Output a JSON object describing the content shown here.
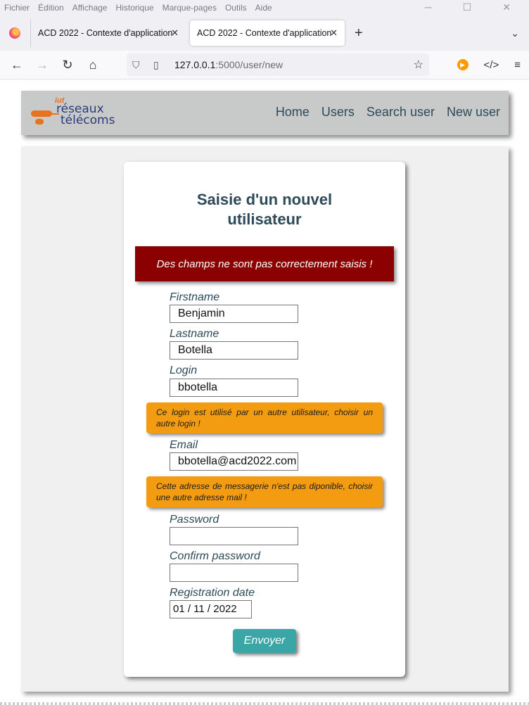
{
  "browser": {
    "menu": [
      "Fichier",
      "Édition",
      "Affichage",
      "Historique",
      "Marque-pages",
      "Outils",
      "Aide"
    ],
    "tabs": [
      {
        "title": "ACD 2022 - Contexte d'application"
      },
      {
        "title": "ACD 2022 - Contexte d'application"
      }
    ],
    "url_host": "127.0.0.1",
    "url_path": ":5000/user/new"
  },
  "site": {
    "logo": {
      "iut": "iut",
      "line1": "réseaux",
      "line2": "télécoms"
    },
    "nav": [
      "Home",
      "Users",
      "Search user",
      "New user"
    ]
  },
  "form": {
    "title": "Saisie d'un nouvel utilisateur",
    "error": "Des champs ne sont pas correctement saisis !",
    "firstname": {
      "label": "Firstname",
      "value": "Benjamin"
    },
    "lastname": {
      "label": "Lastname",
      "value": "Botella"
    },
    "login": {
      "label": "Login",
      "value": "bbotella",
      "warning": "Ce login est utilisé par un autre utilisateur, choisir un autre login !"
    },
    "email": {
      "label": "Email",
      "value": "bbotella@acd2022.com",
      "warning": "Cette adresse de messagerie n'est pas diponible, choisir une autre adresse mail !"
    },
    "password": {
      "label": "Password",
      "value": ""
    },
    "confirm": {
      "label": "Confirm password",
      "value": ""
    },
    "date": {
      "label": "Registration date",
      "value": "01 / 11 / 2022"
    },
    "submit": "Envoyer"
  },
  "colors": {
    "error": "#8b0000",
    "warning": "#f39c12",
    "submit": "#3aa6a6",
    "heading": "#2c4a58"
  }
}
